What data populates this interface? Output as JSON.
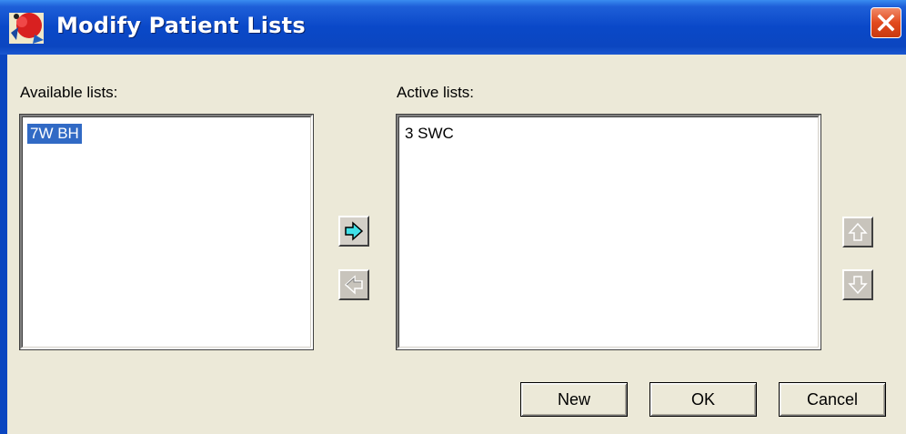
{
  "window": {
    "title": "Modify Patient Lists"
  },
  "available": {
    "label": "Available lists:",
    "items": [
      {
        "text": "7W BH",
        "selected": true
      }
    ]
  },
  "active": {
    "label": "Active lists:",
    "items": [
      {
        "text": "3 SWC",
        "selected": false
      }
    ]
  },
  "buttons": {
    "new": "New",
    "ok": "OK",
    "cancel": "Cancel"
  },
  "icons": {
    "move_right": "arrow-right-icon",
    "move_left": "arrow-left-icon",
    "move_up": "arrow-up-icon",
    "move_down": "arrow-down-icon",
    "close": "close-icon",
    "app": "app-icon"
  },
  "colors": {
    "titlebar": "#0a48c8",
    "selection": "#316ac5",
    "close_button": "#e24a1e",
    "active_arrow": "#40e0e8"
  }
}
